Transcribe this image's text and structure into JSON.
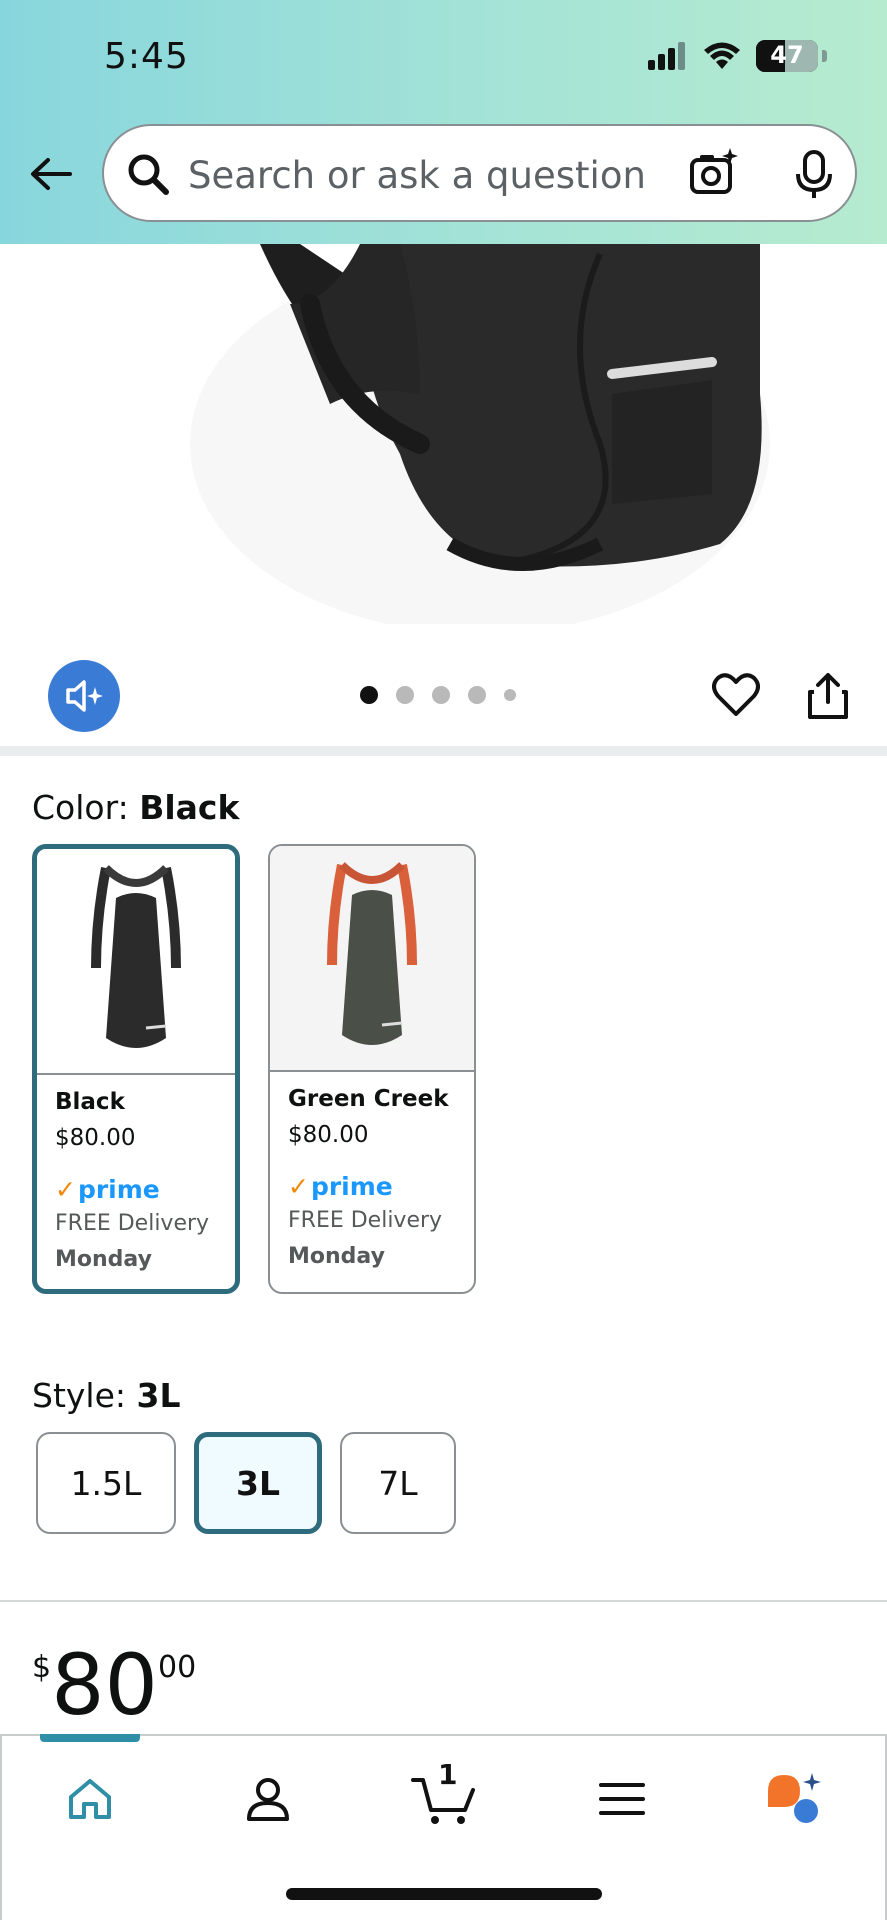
{
  "status_bar": {
    "time": "5:45",
    "battery": "47"
  },
  "search": {
    "placeholder": "Search or ask a question"
  },
  "carousel": {
    "total_dots": 5,
    "active_dot": 1
  },
  "color": {
    "label": "Color: ",
    "selected": "Black",
    "options": [
      {
        "name": "Black",
        "price": "$80.00",
        "prime": "prime",
        "delivery": "FREE Delivery",
        "day": "Monday",
        "selected": true,
        "accent": "#2b2b2b"
      },
      {
        "name": "Green Creek",
        "price": "$80.00",
        "prime": "prime",
        "delivery": "FREE Delivery",
        "day": "Monday",
        "selected": false,
        "accent": "#d9603b"
      }
    ]
  },
  "style": {
    "label": "Style: ",
    "selected": "3L",
    "options": [
      "1.5L",
      "3L",
      "7L"
    ]
  },
  "price": {
    "currency": "$",
    "whole": "80",
    "fraction": "00"
  },
  "bottom_nav": {
    "items": [
      "home-icon",
      "account-icon",
      "cart-icon",
      "menu-icon",
      "rufus-icon"
    ],
    "cart_count": "1"
  },
  "colors": {
    "accent": "#2e6b7d",
    "prime_blue": "#1a98ff",
    "prime_check": "#f08804",
    "audio_blue": "#3a7bd5"
  }
}
